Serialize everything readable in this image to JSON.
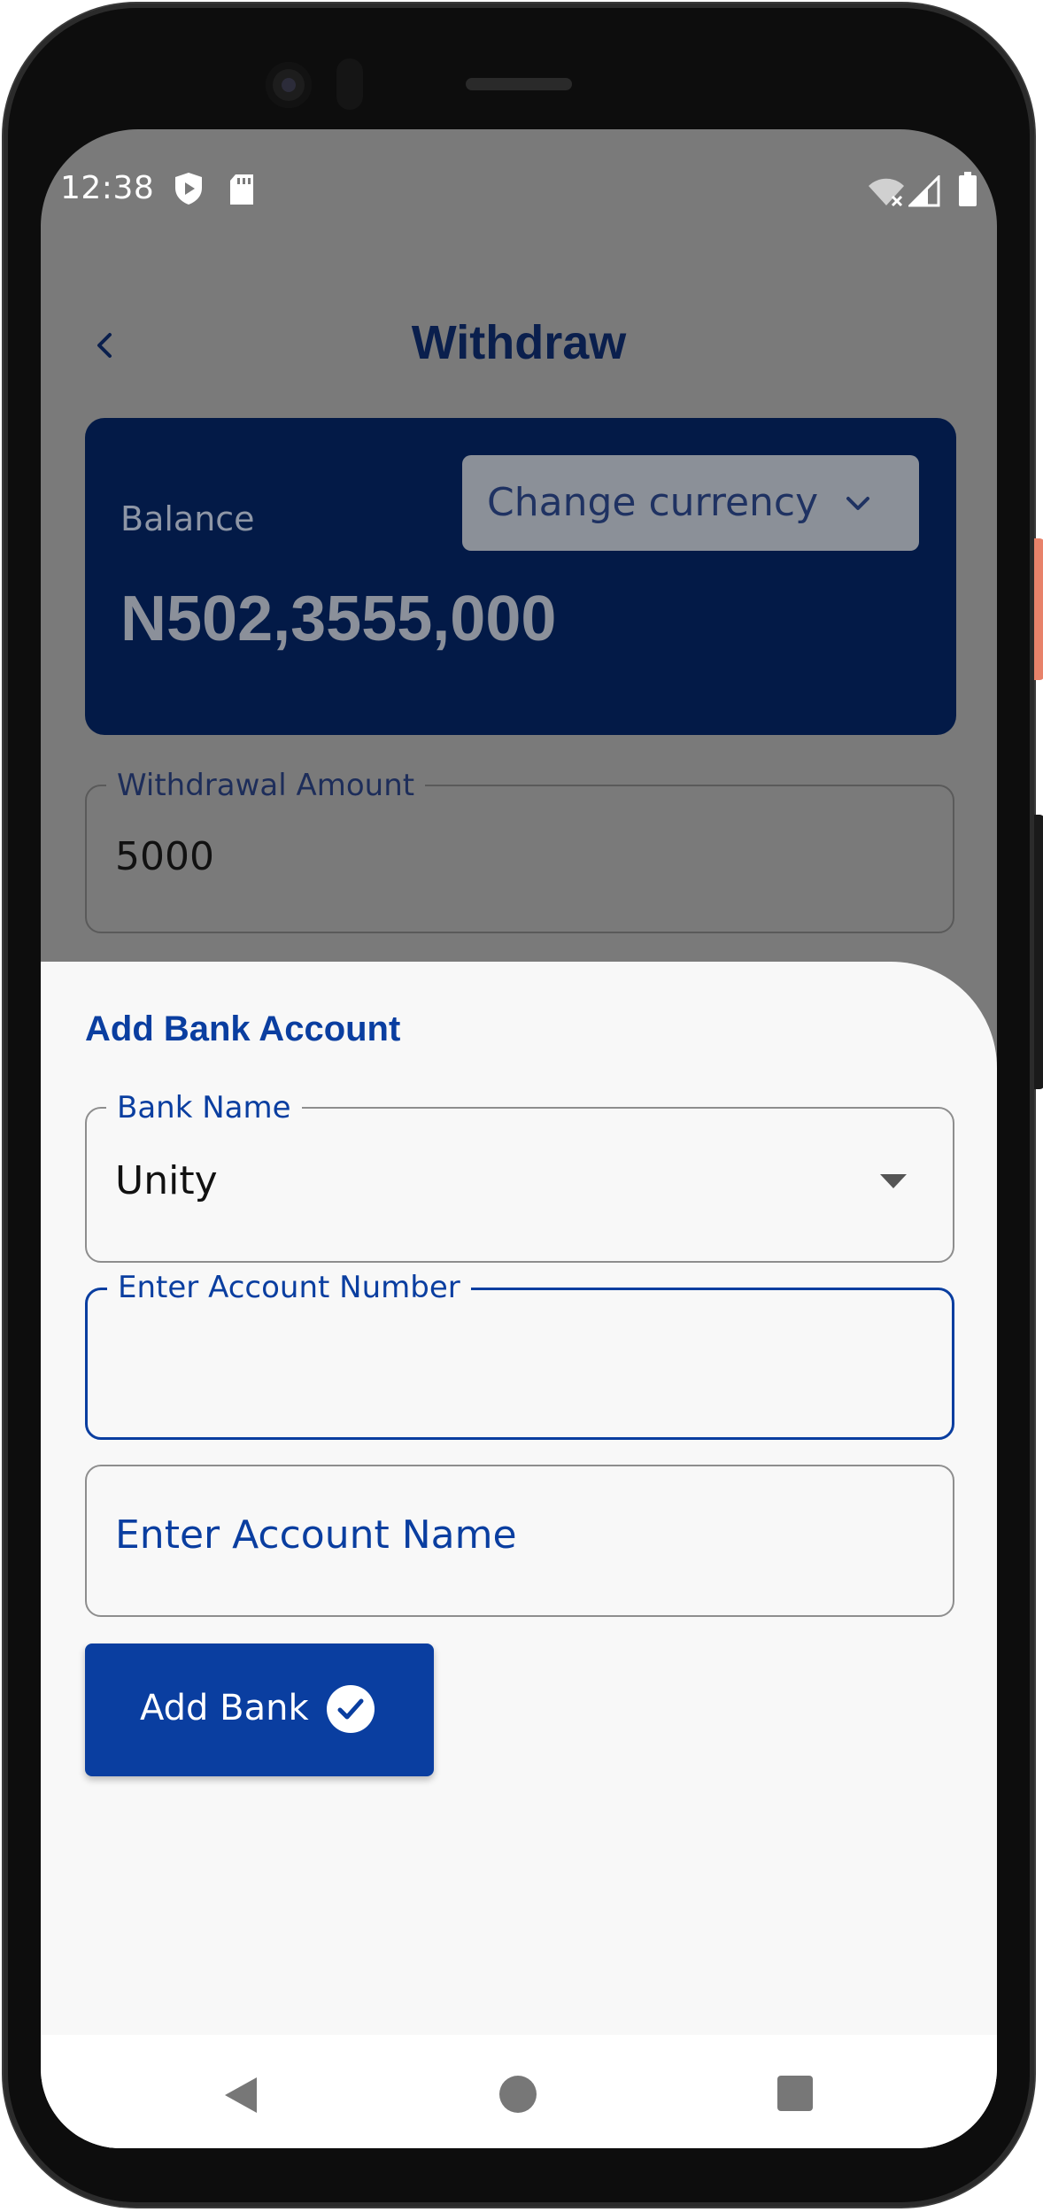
{
  "status_bar": {
    "time": "12:38",
    "icons": [
      "shield-play-icon",
      "sd-card-icon",
      "wifi-off-icon",
      "signal-icon",
      "battery-icon"
    ]
  },
  "app_bar": {
    "title": "Withdraw",
    "back_icon": "chevron-left-icon"
  },
  "balance_card": {
    "label": "Balance",
    "amount": "N502,3555,000",
    "currency_button": "Change currency",
    "currency_icon": "chevron-down-icon"
  },
  "withdraw_form": {
    "amount_label": "Withdrawal Amount",
    "amount_value": "5000"
  },
  "add_bank_sheet": {
    "title": "Add Bank Account",
    "bank_name_label": "Bank Name",
    "bank_name_value": "Unity",
    "account_number_label": "Enter Account Number",
    "account_number_value": "",
    "account_name_placeholder": "Enter Account Name",
    "submit_label": "Add Bank",
    "submit_icon": "check-circle-icon"
  },
  "nav_bar": {
    "icons": [
      "nav-back-icon",
      "nav-home-icon",
      "nav-recents-icon"
    ]
  },
  "colors": {
    "primary": "#0a3ea0",
    "card": "#031a47",
    "scrim": "#7a7a7a",
    "sheet": "#f8f8f8"
  }
}
